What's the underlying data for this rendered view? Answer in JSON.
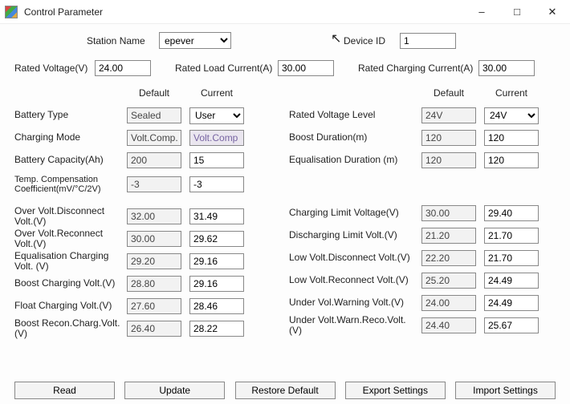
{
  "window": {
    "title": "Control Parameter"
  },
  "top": {
    "station_name_label": "Station Name",
    "station_name_value": "epever",
    "device_id_label": "Device ID",
    "device_id_value": "1",
    "rated_voltage_label": "Rated Voltage(V)",
    "rated_voltage_value": "24.00",
    "rated_load_current_label": "Rated Load Current(A)",
    "rated_load_current_value": "30.00",
    "rated_charging_current_label": "Rated Charging Current(A)",
    "rated_charging_current_value": "30.00"
  },
  "headers": {
    "default": "Default",
    "current": "Current"
  },
  "left": [
    {
      "label": "Battery Type",
      "default": "Sealed",
      "current": "User",
      "current_is_select": true
    },
    {
      "label": "Charging Mode",
      "default": "Volt.Comp.",
      "current": "Volt.Comp",
      "current_readonly": true
    },
    {
      "label": "Battery Capacity(Ah)",
      "default": "200",
      "current": "15"
    },
    {
      "label": "Temp. Compensation Coefficient(mV/°C/2V)",
      "default": "-3",
      "current": "-3"
    }
  ],
  "left2": [
    {
      "label": "Over Volt.Disconnect Volt.(V)",
      "default": "32.00",
      "current": "31.49"
    },
    {
      "label": "Over Volt.Reconnect Volt.(V)",
      "default": "30.00",
      "current": "29.62"
    },
    {
      "label": "Equalisation Charging Volt. (V)",
      "default": "29.20",
      "current": "29.16"
    },
    {
      "label": "Boost Charging Volt.(V)",
      "default": "28.80",
      "current": "29.16"
    },
    {
      "label": "Float Charging Volt.(V)",
      "default": "27.60",
      "current": "28.46"
    },
    {
      "label": "Boost Recon.Charg.Volt.(V)",
      "default": "26.40",
      "current": "28.22"
    }
  ],
  "right": [
    {
      "label": "Rated Voltage Level",
      "default": "24V",
      "current": "24V",
      "current_is_select": true
    },
    {
      "label": "Boost Duration(m)",
      "default": "120",
      "current": "120"
    },
    {
      "label": "Equalisation Duration (m)",
      "default": "120",
      "current": "120"
    }
  ],
  "right2": [
    {
      "label": "Charging Limit Voltage(V)",
      "default": "30.00",
      "current": "29.40"
    },
    {
      "label": "Discharging Limit Volt.(V)",
      "default": "21.20",
      "current": "21.70"
    },
    {
      "label": "Low Volt.Disconnect Volt.(V)",
      "default": "22.20",
      "current": "21.70"
    },
    {
      "label": "Low Volt.Reconnect Volt.(V)",
      "default": "25.20",
      "current": "24.49"
    },
    {
      "label": "Under Vol.Warning Volt.(V)",
      "default": "24.00",
      "current": "24.49"
    },
    {
      "label": "Under Volt.Warn.Reco.Volt.(V)",
      "default": "24.40",
      "current": "25.67"
    }
  ],
  "buttons": {
    "read": "Read",
    "update": "Update",
    "restore": "Restore Default",
    "export": "Export Settings",
    "import": "Import Settings"
  }
}
